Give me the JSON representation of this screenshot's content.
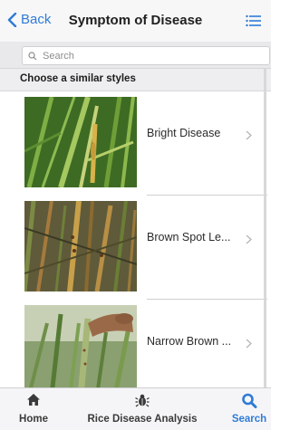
{
  "navbar": {
    "back_label": "Back",
    "title": "Symptom of Disease"
  },
  "search": {
    "placeholder": "Search"
  },
  "section": {
    "heading": "Choose a similar styles"
  },
  "items": [
    {
      "label": "Bright Disease"
    },
    {
      "label": "Brown Spot Le..."
    },
    {
      "label": "Narrow Brown ..."
    }
  ],
  "tabs": [
    {
      "label": "Home",
      "icon": "home-icon"
    },
    {
      "label": "Rice Disease Analysis",
      "icon": "bug-icon"
    },
    {
      "label": "Search",
      "icon": "search-icon",
      "active": true
    }
  ],
  "colors": {
    "accent": "#2f7bd6",
    "text": "#1f1f1f",
    "tab_inactive": "#3a3a3a"
  }
}
